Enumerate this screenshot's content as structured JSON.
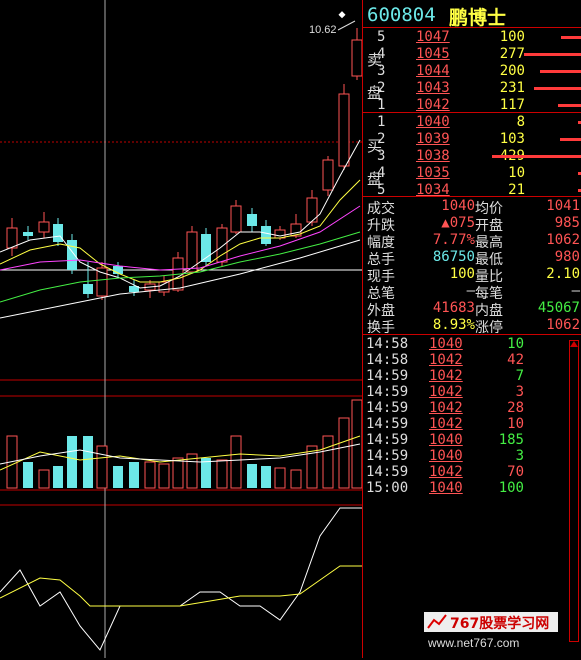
{
  "stock": {
    "code": "600804",
    "name": "鹏博士"
  },
  "chart": {
    "price_label": "10.62"
  },
  "order_book": {
    "ask_label": "卖盘",
    "bid_label": "买盘",
    "asks": [
      {
        "idx": "5",
        "price": "1047",
        "vol": "100"
      },
      {
        "idx": "4",
        "price": "1045",
        "vol": "277"
      },
      {
        "idx": "3",
        "price": "1044",
        "vol": "200"
      },
      {
        "idx": "2",
        "price": "1043",
        "vol": "231"
      },
      {
        "idx": "1",
        "price": "1042",
        "vol": "117"
      }
    ],
    "bids": [
      {
        "idx": "1",
        "price": "1040",
        "vol": "8"
      },
      {
        "idx": "2",
        "price": "1039",
        "vol": "103"
      },
      {
        "idx": "3",
        "price": "1038",
        "vol": "429"
      },
      {
        "idx": "4",
        "price": "1035",
        "vol": "10"
      },
      {
        "idx": "5",
        "price": "1034",
        "vol": "21"
      }
    ]
  },
  "stats": [
    {
      "l1": "成交",
      "v1": "1040",
      "c1": "#ff5454",
      "l2": "均价",
      "v2": "1041",
      "c2": "#ff5454"
    },
    {
      "l1": "升跌",
      "v1": "▲075",
      "c1": "#ff5454",
      "l2": "开盘",
      "v2": "985",
      "c2": "#ff5454"
    },
    {
      "l1": "幅度",
      "v1": "7.77%",
      "c1": "#ff5454",
      "l2": "最高",
      "v2": "1062",
      "c2": "#ff5454"
    },
    {
      "l1": "总手",
      "v1": "86750",
      "c1": "#6ce8e8",
      "l2": "最低",
      "v2": "980",
      "c2": "#ff5454"
    },
    {
      "l1": "现手",
      "v1": "100",
      "c1": "#ffff44",
      "l2": "量比",
      "v2": "2.10",
      "c2": "#ffff44"
    },
    {
      "l1": "总笔",
      "v1": "—",
      "c1": "#ddd",
      "l2": "每笔",
      "v2": "—",
      "c2": "#ddd"
    },
    {
      "l1": "外盘",
      "v1": "41683",
      "c1": "#ff5454",
      "l2": "内盘",
      "v2": "45067",
      "c2": "#44ee44"
    },
    {
      "l1": "换手",
      "v1": "8.93%",
      "c1": "#ffff44",
      "l2": "涨停",
      "v2": "1062",
      "c2": "#ff5454"
    }
  ],
  "ticks": [
    {
      "time": "14:58",
      "price": "1040",
      "vol": "10",
      "color": "#44ee44"
    },
    {
      "time": "14:58",
      "price": "1042",
      "vol": "42",
      "color": "#ff5454"
    },
    {
      "time": "14:59",
      "price": "1042",
      "vol": "7",
      "color": "#44ee44"
    },
    {
      "time": "14:59",
      "price": "1042",
      "vol": "3",
      "color": "#ff5454"
    },
    {
      "time": "14:59",
      "price": "1042",
      "vol": "28",
      "color": "#ff5454"
    },
    {
      "time": "14:59",
      "price": "1042",
      "vol": "10",
      "color": "#ff5454"
    },
    {
      "time": "14:59",
      "price": "1040",
      "vol": "185",
      "color": "#44ee44"
    },
    {
      "time": "14:59",
      "price": "1040",
      "vol": "3",
      "color": "#44ee44"
    },
    {
      "time": "14:59",
      "price": "1042",
      "vol": "70",
      "color": "#ff5454"
    },
    {
      "time": "15:00",
      "price": "1040",
      "vol": "100",
      "color": "#44ee44"
    }
  ],
  "watermark": {
    "title": "767股票学习网",
    "url": "www.net767.com"
  },
  "colors": {
    "up": "#ff5454",
    "down": "#6ce8e8",
    "grid": "#c00000",
    "ma5": "#ffffff",
    "ma10": "#ffff44",
    "ma20": "#ff44ff",
    "ma60": "#44ee44"
  }
}
